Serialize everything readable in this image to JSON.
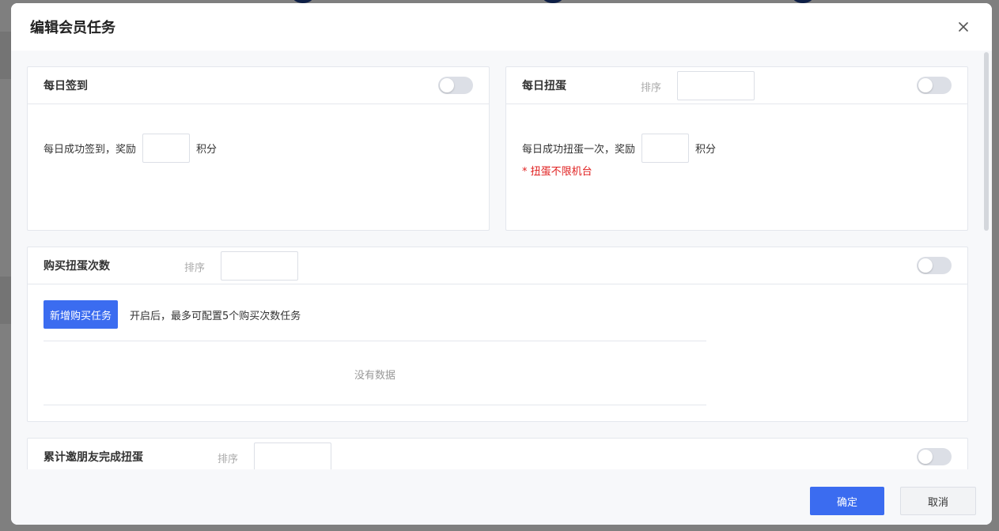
{
  "modal": {
    "title": "编辑会员任务",
    "ok_label": "确定",
    "cancel_label": "取消"
  },
  "daily_checkin": {
    "title": "每日签到",
    "text_before": "每日成功签到，奖励",
    "text_after": "积分",
    "enabled": false
  },
  "daily_gacha": {
    "title": "每日扭蛋",
    "sort_label": "排序",
    "text_before": "每日成功扭蛋一次，奖励",
    "text_after": "积分",
    "warning": "* 扭蛋不限机台",
    "enabled": false
  },
  "buy_gacha": {
    "title": "购买扭蛋次数",
    "sort_label": "排序",
    "add_button": "新增购买任务",
    "hint": "开启后，最多可配置5个购买次数任务",
    "empty_text": "没有数据",
    "enabled": false
  },
  "invite_friends": {
    "title": "累计邀朋友完成扭蛋",
    "sort_label": "排序",
    "enabled": false
  },
  "colors": {
    "primary": "#3b6cf0",
    "warning": "#e02020"
  }
}
